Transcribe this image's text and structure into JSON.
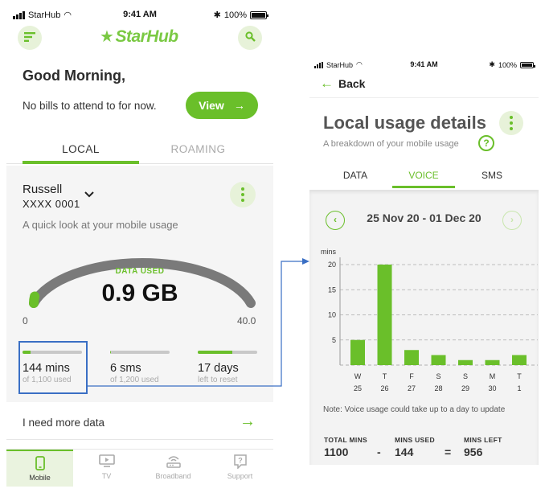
{
  "left_phone": {
    "status": {
      "carrier": "StarHub",
      "time": "9:41 AM",
      "battery": "100%"
    },
    "logo": "StarHub",
    "greeting": "Good Morning,",
    "bills_text": "No bills to attend to for now.",
    "view_button": "View",
    "tabs": [
      {
        "label": "LOCAL",
        "active": true
      },
      {
        "label": "ROAMING",
        "active": false
      }
    ],
    "account": {
      "name": "Russell",
      "number": "XXXX 0001",
      "subtitle": "A quick look at your mobile usage"
    },
    "gauge": {
      "label": "DATA USED",
      "value": "0.9 GB",
      "min_label": "0",
      "max_label": "40.0",
      "used_fraction": 0.0225
    },
    "stats": [
      {
        "value": "144 mins",
        "sub": "of 1,100 used",
        "fill_fraction": 0.13
      },
      {
        "value": "6 sms",
        "sub": "of 1,200 used",
        "fill_fraction": 0.005
      },
      {
        "value": "17 days",
        "sub": "left to reset",
        "fill_fraction": 0.58
      }
    ],
    "need_more": "I need more data",
    "nav": [
      {
        "label": "Mobile",
        "active": true,
        "icon": "phone-icon"
      },
      {
        "label": "TV",
        "active": false,
        "icon": "tv-icon"
      },
      {
        "label": "Broadband",
        "active": false,
        "icon": "router-icon"
      },
      {
        "label": "Support",
        "active": false,
        "icon": "support-icon"
      }
    ]
  },
  "right_phone": {
    "status": {
      "carrier": "StarHub",
      "time": "9:41 AM",
      "battery": "100%"
    },
    "back_label": "Back",
    "title": "Local usage details",
    "subtitle": "A breakdown of your mobile usage",
    "help_symbol": "?",
    "tabs": [
      {
        "label": "DATA",
        "active": false
      },
      {
        "label": "VOICE",
        "active": true
      },
      {
        "label": "SMS",
        "active": false
      }
    ],
    "date_range": "25 Nov 20 - 01 Dec 20",
    "note": "Note: Voice usage could take up to a day to update",
    "totals": {
      "total_label": "TOTAL MINS",
      "total_value": "1100",
      "used_label": "MINS USED",
      "used_value": "144",
      "left_label": "MINS LEFT",
      "left_value": "956",
      "minus": "-",
      "equals": "="
    }
  },
  "chart_data": {
    "type": "bar",
    "ylabel": "mins",
    "ylim": [
      0,
      24
    ],
    "yticks": [
      5,
      10,
      15,
      20
    ],
    "categories": [
      "W",
      "T",
      "F",
      "S",
      "S",
      "M",
      "T"
    ],
    "dates": [
      "25",
      "26",
      "27",
      "28",
      "29",
      "30",
      "1"
    ],
    "values": [
      5,
      20,
      3,
      2,
      1,
      1,
      2
    ],
    "color": "#6abf2a",
    "grid": true
  },
  "colors": {
    "accent": "#6abf2a",
    "accent_light": "#e7f2d9",
    "connector": "#3a6fc4"
  }
}
